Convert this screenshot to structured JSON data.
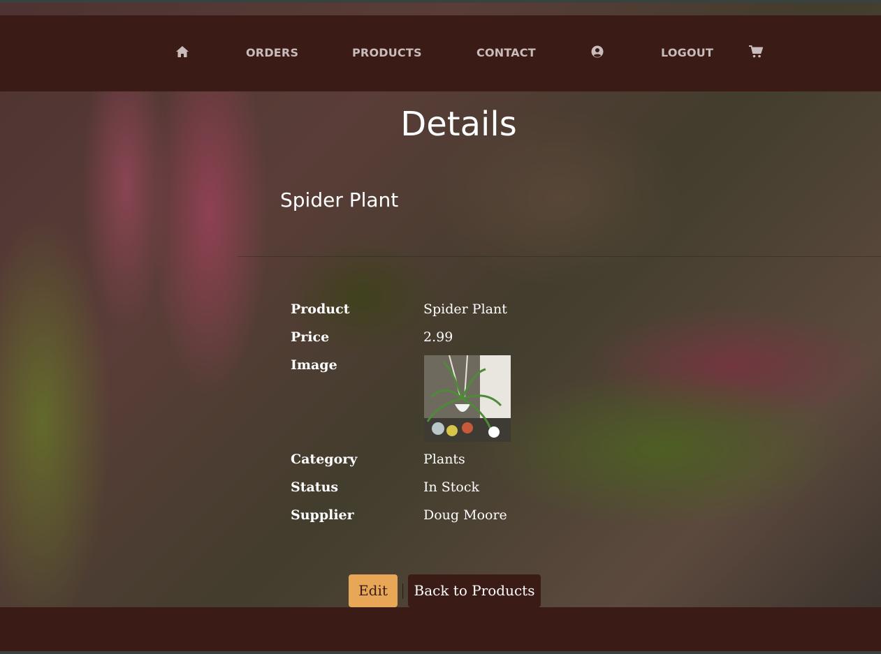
{
  "nav": {
    "home_icon": "home-icon",
    "orders": "ORDERS",
    "products": "PRODUCTS",
    "contact": "CONTACT",
    "account_icon": "user-circle-icon",
    "logout": "LOGOUT",
    "cart_icon": "cart-icon"
  },
  "page": {
    "title": "Details",
    "subtitle": "Spider Plant"
  },
  "details": [
    {
      "label": "Product",
      "value": "Spider Plant"
    },
    {
      "label": "Price",
      "value": "2.99"
    },
    {
      "label": "Image",
      "value": ""
    },
    {
      "label": "Category",
      "value": "Plants"
    },
    {
      "label": "Status",
      "value": "In Stock"
    },
    {
      "label": "Supplier",
      "value": "Doug Moore"
    }
  ],
  "actions": {
    "edit": "Edit",
    "back": "Back to Products"
  },
  "colors": {
    "header_bg": "#3b1b16",
    "accent": "#e8a757",
    "nav_text": "#c9bcbc"
  }
}
